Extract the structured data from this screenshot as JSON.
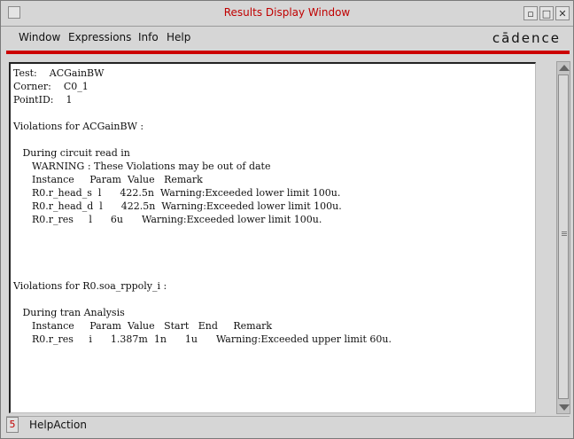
{
  "window": {
    "title": "Results Display Window"
  },
  "window_controls": {
    "minimize": "▫",
    "maximize": "□",
    "close": "✕"
  },
  "menu": {
    "items": [
      "Window",
      "Expressions",
      "Info",
      "Help"
    ],
    "brand": "cādence"
  },
  "content": {
    "lines": [
      "Test:    ACGainBW",
      "Corner:    C0_1",
      "PointID:    1",
      "",
      "Violations for ACGainBW :",
      "",
      "   During circuit read in",
      "      WARNING : These Violations may be out of date",
      "      Instance     Param  Value   Remark",
      "      R0.r_head_s  l      422.5n  Warning:Exceeded lower limit 100u.",
      "      R0.r_head_d  l      422.5n  Warning:Exceeded lower limit 100u.",
      "      R0.r_res     l      6u      Warning:Exceeded lower limit 100u.",
      "",
      "",
      "",
      "",
      "Violations for R0.soa_rppoly_i :",
      "",
      "   During tran Analysis",
      "      Instance     Param  Value   Start   End     Remark",
      "      R0.r_res     i      1.387m  1n      1u      Warning:Exceeded upper limit 60u."
    ]
  },
  "status": {
    "number": "5",
    "text": "HelpAction"
  },
  "colors": {
    "title_text": "#c00000",
    "accent_line": "#cc0000",
    "background": "#d6d6d6"
  }
}
